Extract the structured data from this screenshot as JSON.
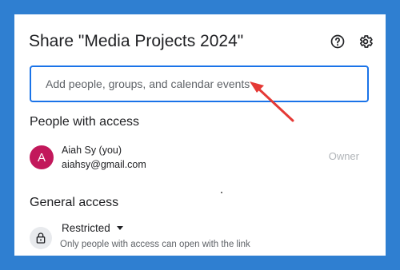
{
  "dialog": {
    "title": "Share \"Media Projects 2024\"",
    "help_icon": "question-circle-icon",
    "settings_icon": "gear-icon"
  },
  "add_people": {
    "placeholder": "Add people, groups, and calendar events",
    "value": ""
  },
  "people_with_access": {
    "heading": "People with access",
    "people": [
      {
        "avatar_letter": "A",
        "avatar_color": "#c2185b",
        "name": "Aiah Sy (you)",
        "email": "aiahsy@gmail.com",
        "role": "Owner"
      }
    ]
  },
  "general_access": {
    "heading": "General access",
    "selected": "Restricted",
    "description": "Only people with access can open with the link",
    "icon": "lock-icon"
  },
  "annotation": {
    "arrow_color": "#e53935"
  },
  "colors": {
    "background": "#2f7fd1",
    "accent": "#1a73e8"
  }
}
